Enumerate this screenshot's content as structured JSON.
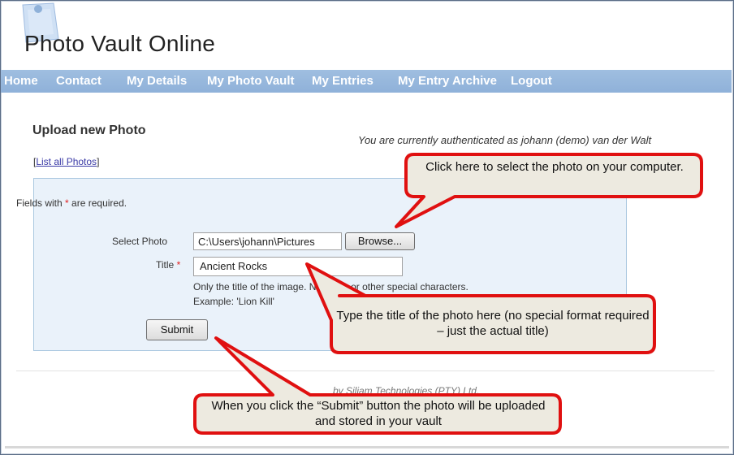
{
  "app": {
    "title": "Photo Vault Online"
  },
  "nav": {
    "items": [
      "Home",
      "Contact",
      "My Details",
      "My Photo Vault",
      "My Entries",
      "My Entry Archive",
      "Logout"
    ]
  },
  "page": {
    "heading": "Upload new Photo",
    "auth_text": "You are currently authenticated as johann (demo) van der Walt",
    "list_link": "List all Photos",
    "required_note": "Fields with",
    "required_note_suffix": "are required."
  },
  "form": {
    "select_photo_label": "Select Photo",
    "file_value": "C:\\Users\\johann\\Pictures",
    "browse_label": "Browse...",
    "title_label": "Title",
    "title_value": "Ancient Rocks",
    "hint_line1": "Only the title of the image. No dates or other special characters.",
    "hint_line2": "Example: 'Lion Kill'",
    "submit_label": "Submit"
  },
  "footer": {
    "text": "by Siliam Technologies (PTY) Ltd."
  },
  "callouts": {
    "select_photo": "Click here to select the photo on your computer.",
    "title": "Type the title of the photo here (no special format required – just the actual title)",
    "submit": "When you click the “Submit” button the photo will be uploaded and stored in your vault"
  },
  "colors": {
    "nav_bg": "#8fb1d9",
    "callout_fill": "#edeae0",
    "callout_border": "#e01010"
  }
}
